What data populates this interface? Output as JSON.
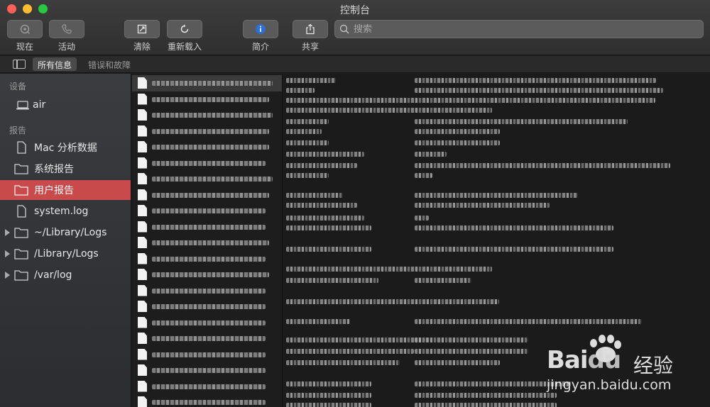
{
  "window": {
    "title": "控制台"
  },
  "toolbar": {
    "buttons": [
      {
        "label": "现在",
        "icon": "target-icon"
      },
      {
        "label": "活动",
        "icon": "phone-icon"
      },
      {
        "label": "清除",
        "icon": "clear-icon"
      },
      {
        "label": "重新载入",
        "icon": "reload-icon"
      },
      {
        "label": "简介",
        "icon": "info-icon"
      },
      {
        "label": "共享",
        "icon": "share-icon"
      }
    ],
    "search_placeholder": "搜索"
  },
  "filterbar": {
    "tabs": [
      "所有信息",
      "错误和故障"
    ],
    "active": "所有信息"
  },
  "sidebar": {
    "sections": [
      {
        "title": "设备",
        "items": [
          {
            "label": "air",
            "icon": "laptop-icon"
          }
        ]
      },
      {
        "title": "报告",
        "items": [
          {
            "label": "Mac 分析数据",
            "icon": "document-icon"
          },
          {
            "label": "系统报告",
            "icon": "folder-icon"
          },
          {
            "label": "用户报告",
            "icon": "folder-icon",
            "selected": true
          },
          {
            "label": "system.log",
            "icon": "document-icon"
          },
          {
            "label": "~/Library/Logs",
            "icon": "folder-icon",
            "expandable": true
          },
          {
            "label": "/Library/Logs",
            "icon": "folder-icon",
            "expandable": true
          },
          {
            "label": "/var/log",
            "icon": "folder-icon",
            "expandable": true
          }
        ]
      }
    ]
  },
  "watermark": {
    "brand_a": "Bai",
    "brand_b": "du",
    "brand_cn": "经验",
    "url": "jingyan.baidu.com"
  },
  "colors": {
    "selection": "#c94a4a",
    "info_accent": "#2f6fd1"
  }
}
